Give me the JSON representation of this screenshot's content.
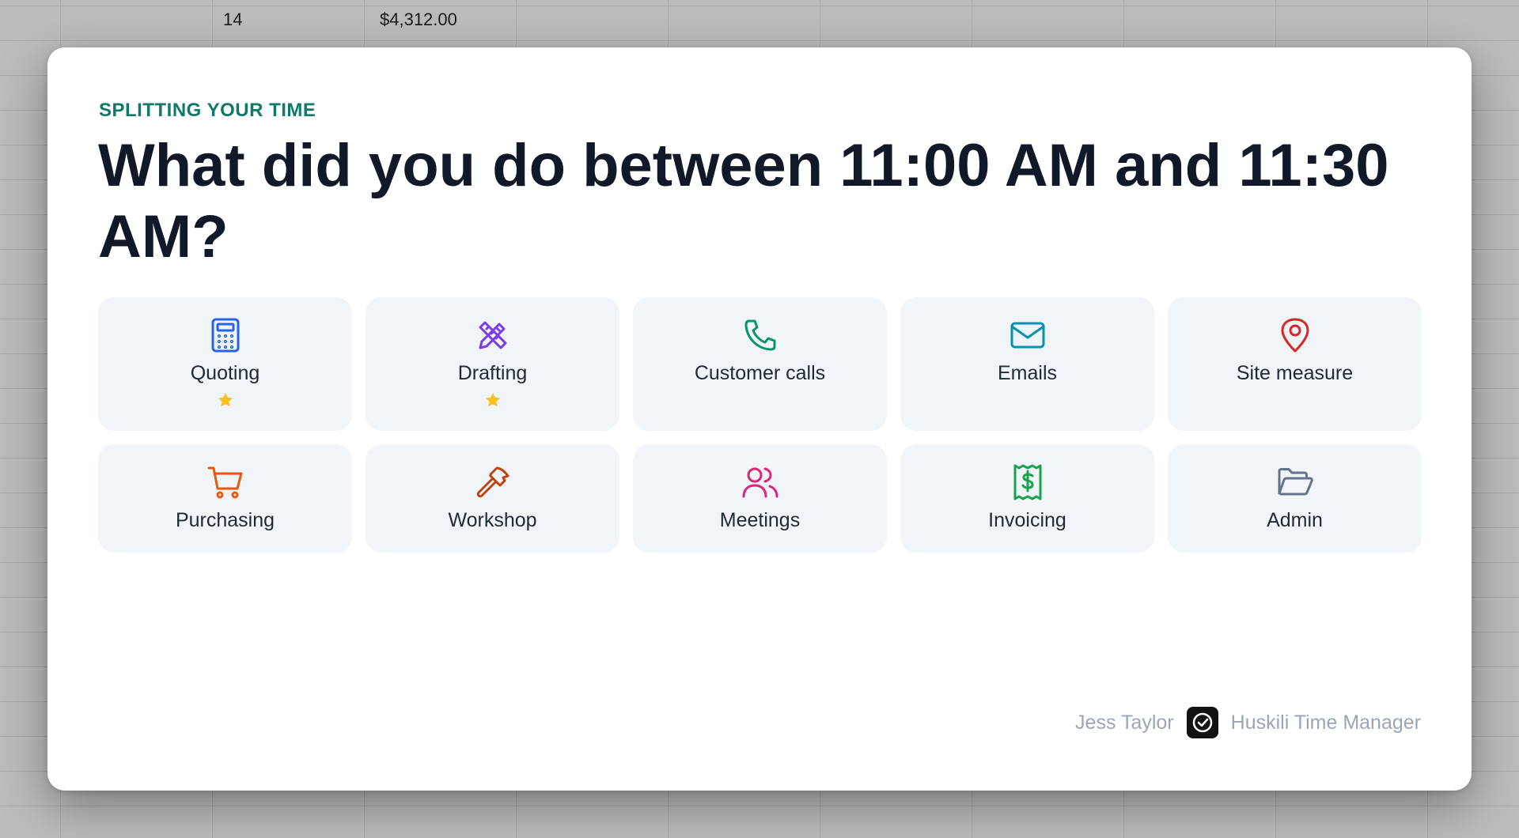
{
  "background_sheet": {
    "row_number": "14",
    "amount": "$4,312.00"
  },
  "modal": {
    "eyebrow": "SPLITTING YOUR TIME",
    "headline": "What did you do between 11:00 AM and 11:30 AM?",
    "activities": [
      {
        "label": "Quoting",
        "icon": "calculator-icon",
        "color": "#2563eb",
        "favorite": true
      },
      {
        "label": "Drafting",
        "icon": "pencil-ruler-icon",
        "color": "#7c3aed",
        "favorite": true
      },
      {
        "label": "Customer calls",
        "icon": "phone-icon",
        "color": "#059669",
        "favorite": false
      },
      {
        "label": "Emails",
        "icon": "mail-icon",
        "color": "#0891b2",
        "favorite": false
      },
      {
        "label": "Site measure",
        "icon": "map-pin-icon",
        "color": "#dc2626",
        "favorite": false
      },
      {
        "label": "Purchasing",
        "icon": "cart-icon",
        "color": "#ea580c",
        "favorite": false
      },
      {
        "label": "Workshop",
        "icon": "hammer-icon",
        "color": "#c2410c",
        "favorite": false
      },
      {
        "label": "Meetings",
        "icon": "users-icon",
        "color": "#db2777",
        "favorite": false
      },
      {
        "label": "Invoicing",
        "icon": "receipt-icon",
        "color": "#16a34a",
        "favorite": false
      },
      {
        "label": "Admin",
        "icon": "folder-open-icon",
        "color": "#64748b",
        "favorite": false
      }
    ],
    "star_color": "#fbbf24",
    "footer": {
      "user_name": "Jess Taylor",
      "app_name": "Huskili Time Manager"
    }
  }
}
